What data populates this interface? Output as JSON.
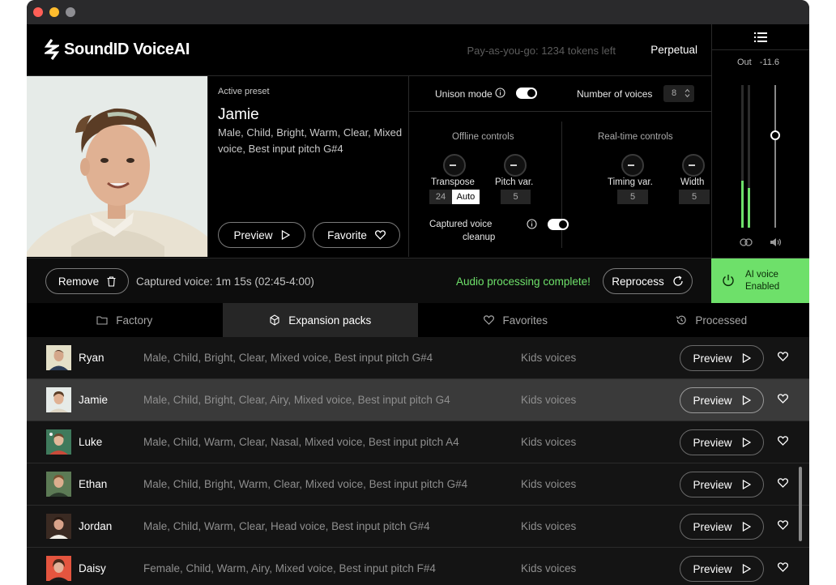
{
  "app": {
    "name": "SoundID VoiceAI",
    "tokens_text": "Pay-as-you-go: 1234 tokens left",
    "perpetual_label": "Perpetual"
  },
  "output": {
    "label": "Out",
    "value": "-11.6",
    "left_meter_level": 0.33,
    "right_meter_level": 0.28,
    "volume_level": 0.65
  },
  "preset": {
    "label": "Active preset",
    "name": "Jamie",
    "tags": "Male, Child, Bright, Warm, Clear, Mixed voice, Best input pitch  G#4",
    "preview_label": "Preview",
    "favorite_label": "Favorite"
  },
  "controls": {
    "unison_label": "Unison mode",
    "voices_label": "Number of voices",
    "voices_value": "8",
    "offline_title": "Offline controls",
    "realtime_title": "Real-time controls",
    "transpose_label": "Transpose",
    "transpose_value": "24",
    "transpose_auto": "Auto",
    "pitchvar_label": "Pitch var.",
    "pitchvar_value": "5",
    "timingvar_label": "Timing var.",
    "timingvar_value": "5",
    "width_label": "Width",
    "width_value": "5",
    "cleanup_label_1": "Captured voice",
    "cleanup_label_2": "cleanup"
  },
  "actions": {
    "remove_label": "Remove",
    "captured_text": "Captured voice: 1m 15s (02:45-4:00)",
    "status_text": "Audio processing complete!",
    "reprocess_label": "Reprocess",
    "ai_line1": "AI voice",
    "ai_line2": "Enabled"
  },
  "tabs": [
    {
      "label": "Factory",
      "icon": "folder-icon",
      "active": false
    },
    {
      "label": "Expansion packs",
      "icon": "package-icon",
      "active": true
    },
    {
      "label": "Favorites",
      "icon": "heart-icon",
      "active": false
    },
    {
      "label": "Processed",
      "icon": "history-icon",
      "active": false
    }
  ],
  "voices": [
    {
      "name": "Ryan",
      "tags": "Male, Child, Bright, Clear, Mixed voice, Best input pitch G#4",
      "pack": "Kids voices",
      "preview": "Preview",
      "selected": false
    },
    {
      "name": "Jamie",
      "tags": "Male, Child, Bright, Clear, Airy, Mixed voice, Best input pitch  G4",
      "pack": "Kids voices",
      "preview": "Preview",
      "selected": true
    },
    {
      "name": "Luke",
      "tags": "Male, Child, Warm, Clear, Nasal, Mixed voice, Best input pitch  A4",
      "pack": "Kids voices",
      "preview": "Preview",
      "selected": false
    },
    {
      "name": "Ethan",
      "tags": "Male, Child, Bright, Warm, Clear, Mixed voice, Best input pitch  G#4",
      "pack": "Kids voices",
      "preview": "Preview",
      "selected": false
    },
    {
      "name": "Jordan",
      "tags": "Male, Child, Warm, Clear, Head voice, Best input pitch  G#4",
      "pack": "Kids voices",
      "preview": "Preview",
      "selected": false
    },
    {
      "name": "Daisy",
      "tags": "Female, Child, Warm, Airy, Mixed voice, Best input pitch  F#4",
      "pack": "Kids voices",
      "preview": "Preview",
      "selected": false
    }
  ],
  "colors": {
    "accent_green": "#6ee06a",
    "background": "#000000",
    "selected_row": "#3a3a3a"
  }
}
